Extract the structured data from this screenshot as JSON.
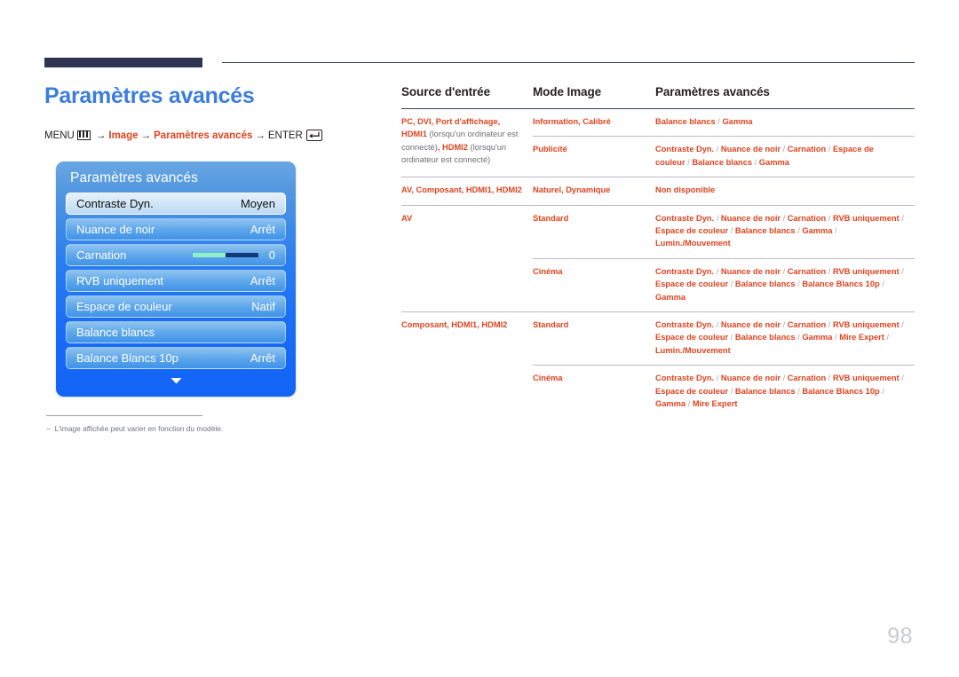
{
  "page_title": "Paramètres avancés",
  "page_number": "98",
  "breadcrumb": {
    "menu_label": "MENU",
    "menu_icon": "menu-bars-icon",
    "arrow": "→",
    "step1": "Image",
    "step2": "Paramètres avancés",
    "enter_label": "ENTER",
    "enter_icon": "enter-return-icon"
  },
  "osd": {
    "title": "Paramètres avancés",
    "chevron_icon": "chevron-down-icon",
    "items": [
      {
        "label": "Contraste Dyn.",
        "value": "Moyen",
        "selected": true
      },
      {
        "label": "Nuance de noir",
        "value": "Arrêt",
        "selected": false
      },
      {
        "label": "Carnation",
        "value": "0",
        "selected": false,
        "slider": true
      },
      {
        "label": "RVB uniquement",
        "value": "Arrêt",
        "selected": false
      },
      {
        "label": "Espace de couleur",
        "value": "Natif",
        "selected": false
      },
      {
        "label": "Balance blancs",
        "value": "",
        "selected": false
      },
      {
        "label": "Balance Blancs 10p",
        "value": "Arrêt",
        "selected": false
      }
    ]
  },
  "footnote": {
    "dash": "–",
    "text": "L'image affichée peut varier en fonction du modèle."
  },
  "table": {
    "headers": [
      "Source d'entrée",
      "Mode Image",
      "Paramètres avancés"
    ],
    "rows": [
      {
        "source": "PC, DVI, Port d'affichage, HDMI1 (lorsqu'un ordinateur est connecté), HDMI2 (lorsqu'un ordinateur est connecté)",
        "mode": "Information, Calibré",
        "settings": "Balance blancs / Gamma"
      },
      {
        "source": "",
        "mode": "Publicité",
        "settings": "Contraste Dyn. / Nuance de noir / Carnation / Espace de couleur / Balance blancs / Gamma"
      },
      {
        "source": "AV, Composant, HDMI1, HDMI2",
        "mode": "Naturel, Dynamique",
        "settings": "Non disponible"
      },
      {
        "source": "AV",
        "mode": "Standard",
        "settings": "Contraste Dyn. / Nuance de noir / Carnation / RVB uniquement / Espace de couleur / Balance blancs / Gamma / Lumin./Mouvement"
      },
      {
        "source": "",
        "mode": "Cinéma",
        "settings": "Contraste Dyn. / Nuance de noir / Carnation / RVB uniquement / Espace de couleur / Balance blancs / Balance Blancs 10p / Gamma"
      },
      {
        "source": "Composant, HDMI1, HDMI2",
        "mode": "Standard",
        "settings": "Contraste Dyn. / Nuance de noir / Carnation / RVB uniquement / Espace de couleur / Balance blancs / Gamma / Mire Expert / Lumin./Mouvement"
      },
      {
        "source": "",
        "mode": "Cinéma",
        "settings": "Contraste Dyn. / Nuance de noir / Carnation / RVB uniquement / Espace de couleur / Balance blancs / Balance Blancs 10p / Gamma / Mire Expert"
      }
    ]
  },
  "colors": {
    "accent_red": "#e0431f",
    "title_blue": "#3b7ddd",
    "rule_navy": "#2e3552",
    "muted_gray": "#6d6e72",
    "page_number_gray": "#c9cacd"
  }
}
